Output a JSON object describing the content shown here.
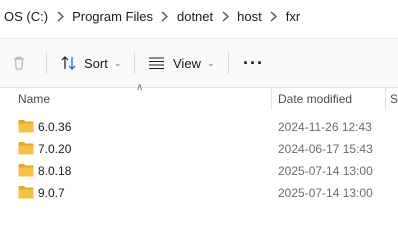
{
  "breadcrumb": [
    "OS (C:)",
    "Program Files",
    "dotnet",
    "host",
    "fxr"
  ],
  "toolbar": {
    "sort_label": "Sort",
    "view_label": "View",
    "more_label": "···"
  },
  "columns": {
    "name": "Name",
    "date_modified": "Date modified",
    "size_partial": "Si"
  },
  "rows": [
    {
      "name": "6.0.36",
      "date": "2024-11-26 12:43"
    },
    {
      "name": "7.0.20",
      "date": "2024-06-17 15:43"
    },
    {
      "name": "8.0.18",
      "date": "2025-07-14 13:00"
    },
    {
      "name": "9.0.7",
      "date": "2025-07-14 13:00"
    }
  ],
  "colors": {
    "folder": "#F5C242",
    "folder_dark": "#E0A92A",
    "accent": "#0067C0"
  },
  "icons": {
    "delete": "trash-icon",
    "sort": "sort-arrows-icon",
    "view": "view-list-icon",
    "folder": "folder-icon",
    "separator": "chevron-right-icon"
  }
}
